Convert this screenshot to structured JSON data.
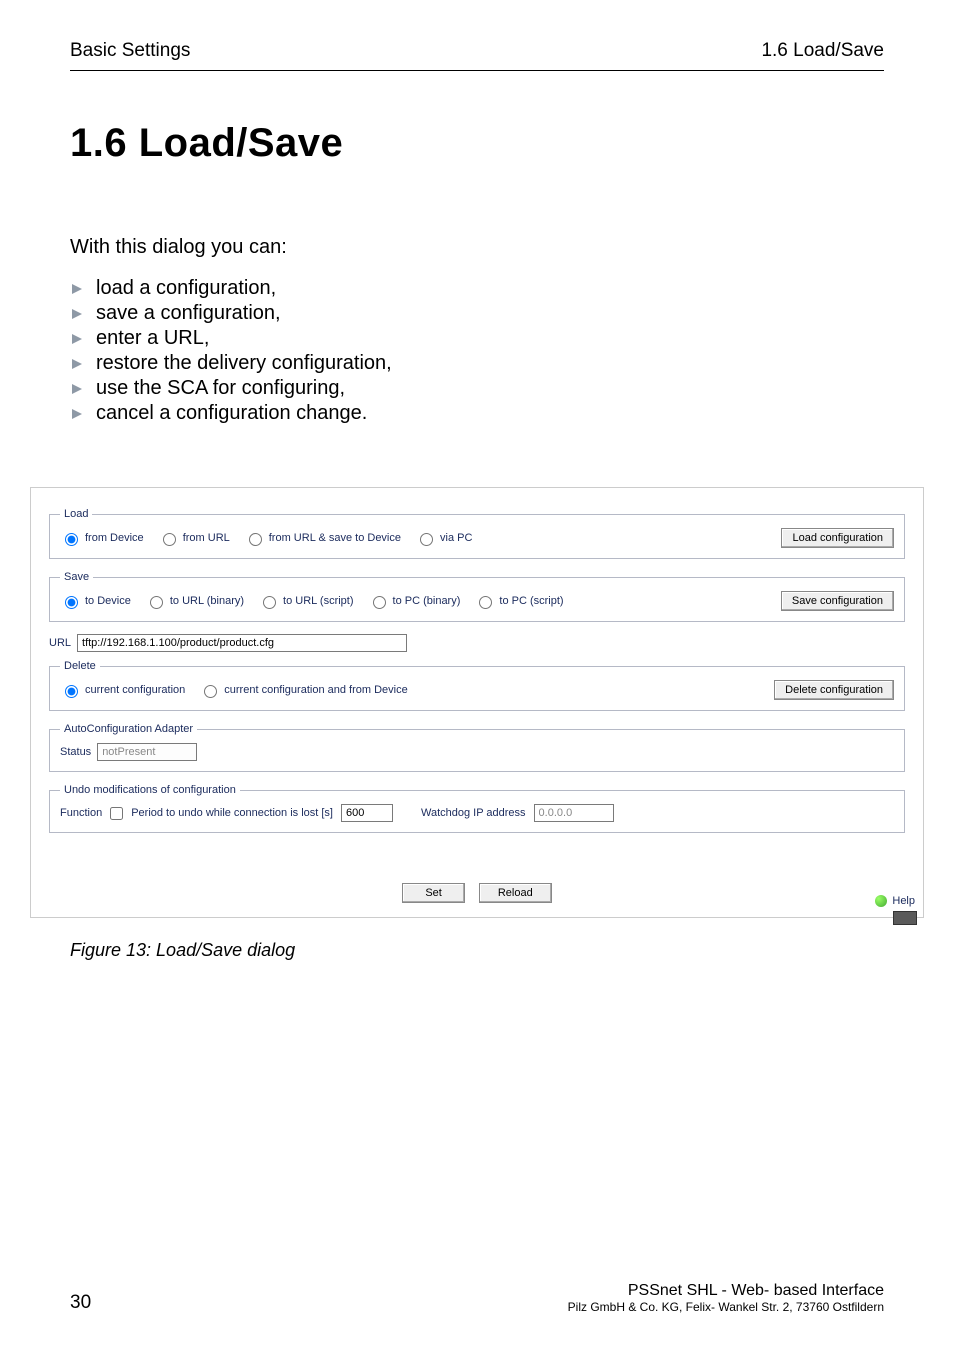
{
  "header": {
    "left": "Basic Settings",
    "right": "1.6  Load/Save"
  },
  "title": "1.6   Load/Save",
  "intro": "With this dialog you can:",
  "bullets": [
    "load a configuration,",
    "save a configuration,",
    "enter a URL,",
    "restore the delivery configuration,",
    "use the SCA for configuring,",
    "cancel a configuration change."
  ],
  "dialog": {
    "load": {
      "legend": "Load",
      "options": [
        "from Device",
        "from URL",
        "from URL & save to Device",
        "via PC"
      ],
      "button": "Load configuration"
    },
    "save": {
      "legend": "Save",
      "options": [
        "to Device",
        "to URL (binary)",
        "to URL (script)",
        "to PC (binary)",
        "to PC (script)"
      ],
      "button": "Save configuration"
    },
    "url": {
      "label": "URL",
      "value": "tftp://192.168.1.100/product/product.cfg"
    },
    "delete": {
      "legend": "Delete",
      "options": [
        "current configuration",
        "current configuration and from Device"
      ],
      "button": "Delete configuration"
    },
    "aca": {
      "legend": "AutoConfiguration Adapter",
      "status_label": "Status",
      "status_value": "notPresent"
    },
    "undo": {
      "legend": "Undo modifications of configuration",
      "function_label": "Function",
      "period_label": "Period to undo while connection is lost [s]",
      "period_value": "600",
      "watchdog_label": "Watchdog IP address",
      "watchdog_value": "0.0.0.0"
    },
    "bottom": {
      "set": "Set",
      "reload": "Reload"
    },
    "help": "Help"
  },
  "caption": "Figure 13: Load/Save dialog",
  "footer": {
    "page": "30",
    "title": "PSSnet SHL - Web- based Interface",
    "sub": "Pilz GmbH & Co. KG, Felix- Wankel Str. 2, 73760 Ostfildern"
  }
}
